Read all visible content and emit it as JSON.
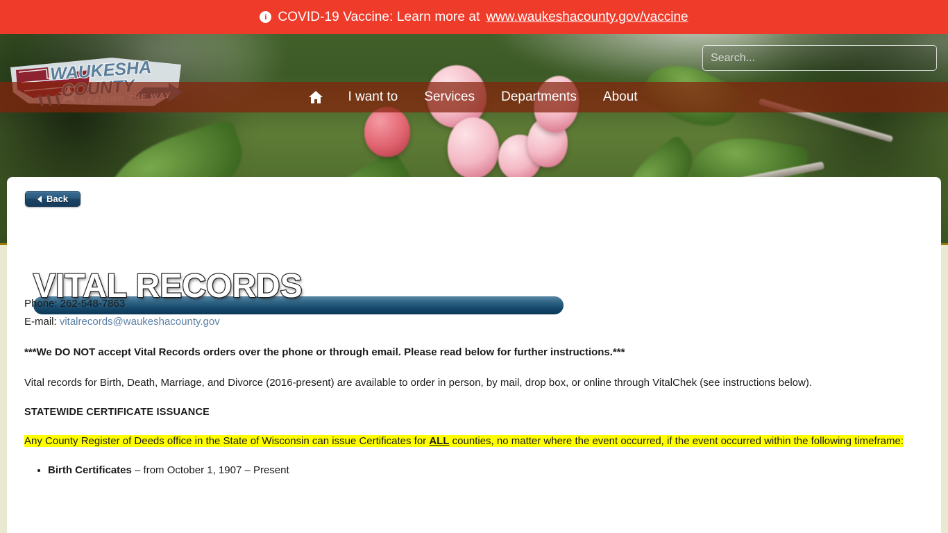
{
  "banner": {
    "icon": "info-circle-icon",
    "text": "COVID-19 Vaccine: Learn more at ",
    "link_text": "www.waukeshacounty.gov/vaccine",
    "bg_color": "#ef3b2a"
  },
  "logo": {
    "line1": "WAUKESHA",
    "line2": "COUNTY",
    "tagline": "LEADING THE WAY",
    "shape_color": "#8e2230",
    "text_color": "#5b7d98"
  },
  "search": {
    "placeholder": "Search...",
    "value": ""
  },
  "nav": {
    "items": [
      {
        "label": "",
        "icon": "home-icon"
      },
      {
        "label": "I want to",
        "icon": ""
      },
      {
        "label": "Services",
        "icon": ""
      },
      {
        "label": "Departments",
        "icon": ""
      },
      {
        "label": "About",
        "icon": ""
      }
    ],
    "bg_color": "#85220c"
  },
  "page": {
    "back_label": "Back",
    "title": "VITAL RECORDS",
    "accent_color": "#14466a"
  },
  "content": {
    "phone_label": "Phone:",
    "phone_value": " 262-548-7863",
    "email_label": "E-mail:",
    "email_value": "vitalrecords@waukeshacounty.gov",
    "notice": "***We DO NOT accept Vital Records orders over the phone or through email.  Please read below for further instructions.***",
    "intro": "Vital records for Birth, Death, Marriage, and Divorce (2016-present) are available to order in person, by mail, drop box, or online through VitalChek (see instructions below).",
    "section_heading": "STATEWIDE CERTIFICATE ISSUANCE",
    "highlight_pre": "Any County Register of Deeds office in the State of Wisconsin can issue Certificates for ",
    "highlight_emphasis": "ALL",
    "highlight_post": " counties, no matter where the event occurred, if the event occurred within the following timeframe:",
    "bullets": [
      {
        "label": "Birth Certificates",
        "text": " – from October 1, 1907 – Present"
      }
    ],
    "highlight_color": "#ffff00"
  }
}
